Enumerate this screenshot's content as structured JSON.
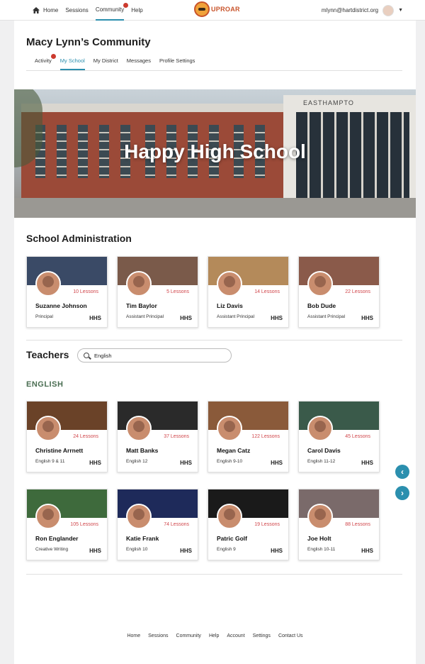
{
  "topnav": {
    "items": [
      "Home",
      "Sessions",
      "Community",
      "Help"
    ],
    "active": "Community"
  },
  "logo": {
    "text": "UPROAR"
  },
  "account": {
    "email": "mlynn@hartdistrict.org"
  },
  "page": {
    "title": "Macy Lynn’s Community"
  },
  "tabs": [
    "Activity",
    "My School",
    "My District",
    "Messages",
    "Profile Settings"
  ],
  "hero": {
    "title": "Happy High School",
    "sign": "EASTHAMPTO"
  },
  "admin": {
    "title": "School Administration",
    "cards": [
      {
        "lessons": "10 Lessons",
        "name": "Suzanne Johnson",
        "role": "Principal",
        "school": "HHS",
        "banner": "#3a4a66"
      },
      {
        "lessons": "5 Lessons",
        "name": "Tim Baylor",
        "role": "Assistant Principal",
        "school": "HHS",
        "banner": "#7a5a4a"
      },
      {
        "lessons": "14 Lessons",
        "name": "Liz Davis",
        "role": "Assistant Principal",
        "school": "HHS",
        "banner": "#b48a5a"
      },
      {
        "lessons": "22 Lessons",
        "name": "Bob Dude",
        "role": "Assistant Principal",
        "school": "HHS",
        "banner": "#8a5a4a"
      }
    ]
  },
  "teachers": {
    "title": "Teachers",
    "search_value": "English",
    "subject": "ENGLISH",
    "row1": [
      {
        "lessons": "24 Lessons",
        "name": "Christine Arrnett",
        "role": "English 9 & 11",
        "school": "HHS",
        "banner": "#6a4228"
      },
      {
        "lessons": "37 Lessons",
        "name": "Matt Banks",
        "role": "English 12",
        "school": "HHS",
        "banner": "#2a2a2a"
      },
      {
        "lessons": "122 Lessons",
        "name": "Megan Catz",
        "role": "English 9-10",
        "school": "HHS",
        "banner": "#8a5a3a"
      },
      {
        "lessons": "45 Lessons",
        "name": "Carol Davis",
        "role": "English 11-12",
        "school": "HHS",
        "banner": "#3a5a4a"
      }
    ],
    "row2": [
      {
        "lessons": "105 Lessons",
        "name": "Ron Englander",
        "role": "Creative Writing",
        "school": "HHS",
        "banner": "#3e6a3c"
      },
      {
        "lessons": "74 Lessons",
        "name": "Katie Frank",
        "role": "English 10",
        "school": "HHS",
        "banner": "#1e2a5a"
      },
      {
        "lessons": "19 Lessons",
        "name": "Patric Golf",
        "role": "English 9",
        "school": "HHS",
        "banner": "#1a1a1a"
      },
      {
        "lessons": "88 Lessons",
        "name": "Joe Holt",
        "role": "English 10-11",
        "school": "HHS",
        "banner": "#7a6a6a"
      }
    ]
  },
  "arrows": {
    "prev": "‹",
    "next": "›"
  },
  "footer": [
    "Home",
    "Sessions",
    "Community",
    "Help",
    "Account",
    "Settings",
    "Contact Us"
  ]
}
